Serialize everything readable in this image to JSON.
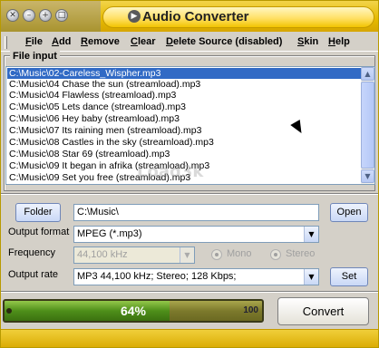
{
  "window": {
    "title": "Audio Converter",
    "accent_color": "#e5b900"
  },
  "menu": {
    "items": [
      {
        "label": "File",
        "underline": "F",
        "rest": "ile"
      },
      {
        "label": "Add",
        "underline": "A",
        "rest": "dd"
      },
      {
        "label": "Remove",
        "underline": "R",
        "rest": "emove"
      },
      {
        "label": "Clear",
        "underline": "C",
        "rest": "lear"
      },
      {
        "label": "Delete Source (disabled)",
        "underline": "D",
        "rest": "elete Source (disabled)"
      },
      {
        "label": "Skin",
        "underline": "S",
        "rest": "kin"
      },
      {
        "label": "Help",
        "underline": "H",
        "rest": "elp"
      }
    ]
  },
  "file_input": {
    "label": "File input",
    "files": [
      "C:\\Music\\02-Careless_Wispher.mp3",
      "C:\\Music\\04 Chase the sun (streamload).mp3",
      "C:\\Music\\04 Flawless (streamload).mp3",
      "C:\\Music\\05 Lets dance (streamload).mp3",
      "C:\\Music\\06 Hey baby (streamload).mp3",
      "C:\\Music\\07 Its raining men (streamload).mp3",
      "C:\\Music\\08 Castles in the sky (streamload).mp3",
      "C:\\Music\\08 Star 69 (streamload).mp3",
      "C:\\Music\\09 It began in afrika (streamload).mp3",
      "C:\\Music\\09 Set you free (streamload).mp3"
    ],
    "selected_index": 0,
    "watermark": "Load3k"
  },
  "output": {
    "folder_button": "Folder",
    "folder_value": "C:\\Music\\",
    "open_button": "Open",
    "format_label": "Output format",
    "format_value": "MPEG (*.mp3)",
    "frequency_label": "Frequency",
    "frequency_value": "44,100 kHz",
    "mono_label": "Mono",
    "stereo_label": "Stereo",
    "rate_label": "Output rate",
    "rate_value": "MP3 44,100 kHz; Stereo;  128 Kbps;",
    "set_button": "Set"
  },
  "progress": {
    "percent_text": "64%",
    "value": 0.64,
    "end_label": "100"
  },
  "convert_button": "Convert"
}
